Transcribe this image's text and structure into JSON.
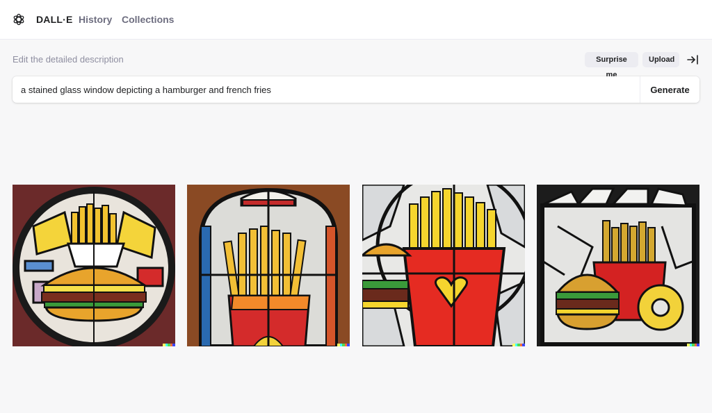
{
  "header": {
    "brand": "DALL·E",
    "nav": [
      "History",
      "Collections"
    ],
    "logo_icon": "openai-logo-icon"
  },
  "editor": {
    "label": "Edit the detailed description",
    "surprise_label": "Surprise me",
    "upload_label": "Upload",
    "collapse_icon": "arrow-to-right-icon",
    "prompt_value": "a stained glass window depicting a hamburger and french fries",
    "generate_label": "Generate"
  },
  "results": {
    "count": 4,
    "alt": "a stained glass window depicting a hamburger and french fries"
  },
  "colors": {
    "accent_text": "#202123",
    "muted_text": "#6e6e80",
    "pill_bg": "#ececf1",
    "page_bg": "#f7f7f8",
    "watermark": [
      "#ffff66",
      "#42ffff",
      "#51da4c",
      "#ff6e3c",
      "#3c46ff"
    ]
  }
}
